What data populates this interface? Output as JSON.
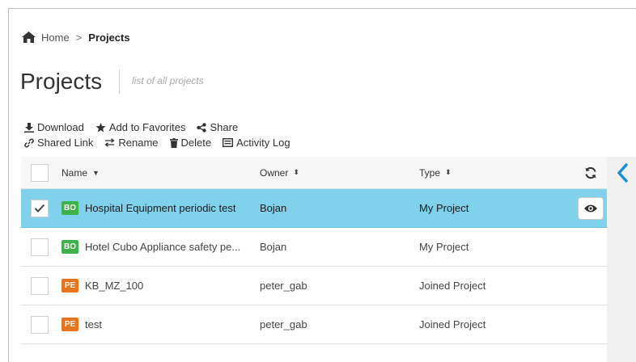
{
  "breadcrumb": {
    "home": "Home",
    "separator": ">",
    "current": "Projects"
  },
  "page": {
    "title": "Projects",
    "subtitle": "list of all projects"
  },
  "toolbar": {
    "row1": [
      {
        "label": "Download",
        "icon": "download-icon"
      },
      {
        "label": "Add to Favorites",
        "icon": "star-icon"
      },
      {
        "label": "Share",
        "icon": "share-icon"
      }
    ],
    "row2": [
      {
        "label": "Shared Link",
        "icon": "link-icon"
      },
      {
        "label": "Rename",
        "icon": "rename-icon"
      },
      {
        "label": "Delete",
        "icon": "trash-icon"
      },
      {
        "label": "Activity Log",
        "icon": "activity-log-icon"
      }
    ]
  },
  "table": {
    "columns": {
      "name": "Name",
      "owner": "Owner",
      "type": "Type"
    },
    "rows": [
      {
        "badge": "BO",
        "name": "Hospital Equipment periodic test",
        "owner": "Bojan",
        "type": "My Project",
        "selected": true
      },
      {
        "badge": "BO",
        "name": "Hotel Cubo Appliance safety pe...",
        "owner": "Bojan",
        "type": "My Project",
        "selected": false
      },
      {
        "badge": "PE",
        "name": "KB_MZ_100",
        "owner": "peter_gab",
        "type": "Joined Project",
        "selected": false
      },
      {
        "badge": "PE",
        "name": "test",
        "owner": "peter_gab",
        "type": "Joined Project",
        "selected": false
      }
    ]
  },
  "colors": {
    "selected_row": "#7fd1ec",
    "badge_bo": "#3cb44b",
    "badge_pe": "#e8741d",
    "accent": "#1a8fd8"
  }
}
